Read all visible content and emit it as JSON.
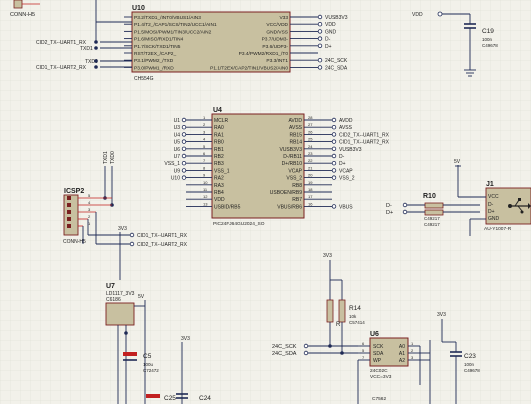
{
  "u10": {
    "ref": "U10",
    "part": "CH554G",
    "left_pins": [
      "P3.2/TXD1_/INT0/VBUS1/AIN3",
      "P1.4/T2_/CAP1/SCS/TIN2/UCC1/AIN1",
      "P1.5/MOSI/PWM1/TIN3/UCC2/AIN2",
      "P1.6/MISO/RXD1/TIN4",
      "P1.7/SCK/TXD1/TIN5",
      "RST/T2EX_/CAP2_",
      "P3.1/PWM2_/TXD",
      "P3.0/PWM1_/RXD"
    ],
    "right_pins": [
      "V33",
      "VCC/VDD",
      "GND/VSS",
      "P3.7/UDM3-",
      "P3.6/UDP3-",
      "P3.4/PWM2/RXD1_/T0",
      "P3.3/INT1",
      "P1.1/T2EX/CAP2/TIN1/VBUS2/AIN0"
    ],
    "right_nets": [
      "VUSB3V3",
      "VDD",
      "GND",
      "D-",
      "D+",
      "",
      "24C_SCK",
      "24C_SDA"
    ],
    "left_nets": [
      "CID2_TX--UART1_RX",
      "TXD1",
      "TXD",
      "CID1_TX--UART2_RX"
    ],
    "left_net_lines": [
      "CID2_TX--UART1_RX",
      "TXD1",
      "TXD0",
      "CID1_TX--UART2_RX"
    ],
    "top_left": "CONN-H5"
  },
  "u4": {
    "ref": "U4",
    "part": "PIC24FJ64GU2024_SO",
    "left_pins": [
      "MCLR",
      "RA0",
      "RA1",
      "RB0",
      "RB1",
      "RB2",
      "RB3",
      "VSS_1",
      "RA2",
      "RA3",
      "RB4",
      "VDD",
      "USBID/RB5"
    ],
    "right_pins": [
      "AVDD",
      "AVSS",
      "RB15",
      "RB14",
      "VUSB3V3",
      "D-/RB11",
      "D+/RB10",
      "VCAP",
      "VSS_2",
      "RB8",
      "USBOEN/RB9",
      "RB7",
      "VBUS/RB6"
    ],
    "left_pin_nums": [
      "1",
      "2",
      "3",
      "4",
      "5",
      "6",
      "7",
      "8",
      "9",
      "10",
      "11",
      "12",
      "13"
    ],
    "right_pin_nums": [
      "28",
      "27",
      "26",
      "25",
      "24",
      "23",
      "22",
      "21",
      "20",
      "19",
      "18",
      "17",
      "16"
    ],
    "left_nets": [
      "U1",
      "U3",
      "U4",
      "U5",
      "U6",
      "U7",
      "VSS_1",
      "U9",
      "U10",
      "",
      "",
      "",
      ""
    ],
    "right_nets": [
      "AVDD",
      "AVSS",
      "CID2_TX--UART1_RX",
      "CID1_TX--UART2_RX",
      "VUSB3V3",
      "D-",
      "D+",
      "VCAP",
      "VSS_2",
      "",
      "",
      "",
      "VBUS"
    ],
    "vertical_labels": [
      "TXD1",
      "TXD0"
    ]
  },
  "icsp": {
    "ref": "ICSP2",
    "part": "CONN-H5",
    "pins": [
      "5",
      "4",
      "3",
      "2",
      "1"
    ],
    "nets": [
      "CID1_TX--UART1_RX",
      "CID2_TX--UART2_RX"
    ],
    "supply": "3V3"
  },
  "r10": {
    "ref": "R10",
    "part": "C49217",
    "part2": "C49217",
    "nets": [
      "D-",
      "D+"
    ]
  },
  "j1": {
    "ref": "J1",
    "part": "AU-Y1007-R",
    "pins": [
      "VCC",
      "D-",
      "D+",
      "GND"
    ],
    "supply": "5V"
  },
  "u7": {
    "ref": "U7",
    "part": "LD1117_3V3",
    "sub": "C6186",
    "supply": "5V"
  },
  "caps": {
    "c5": {
      "ref": "C5",
      "value": "100u",
      "part": "C72472"
    },
    "c19": {
      "ref": "C19",
      "value": "100n",
      "part": "C49678"
    },
    "c23": {
      "ref": "C23",
      "value": "100n",
      "part": "C49678"
    },
    "c25": {
      "ref": "C25"
    },
    "c24": {
      "ref": "C24"
    }
  },
  "r14": {
    "ref": "R14",
    "value": "10k",
    "part": "C57414",
    "ref2": "R"
  },
  "u6": {
    "ref": "U6",
    "part": "24C02C",
    "sub": "VCC=3V3",
    "left_pins": [
      "SCK",
      "SDA",
      "WP"
    ],
    "right_pins": [
      "A0",
      "A1",
      "A2"
    ],
    "left_nums": [
      "6",
      "5",
      "7"
    ],
    "right_nums": [
      "1",
      "2",
      "3"
    ],
    "nets": [
      "24C_SCK",
      "24C_SDA"
    ],
    "part2": "C7562"
  },
  "supplies": {
    "v3v3": "3V3",
    "v5": "5V"
  }
}
